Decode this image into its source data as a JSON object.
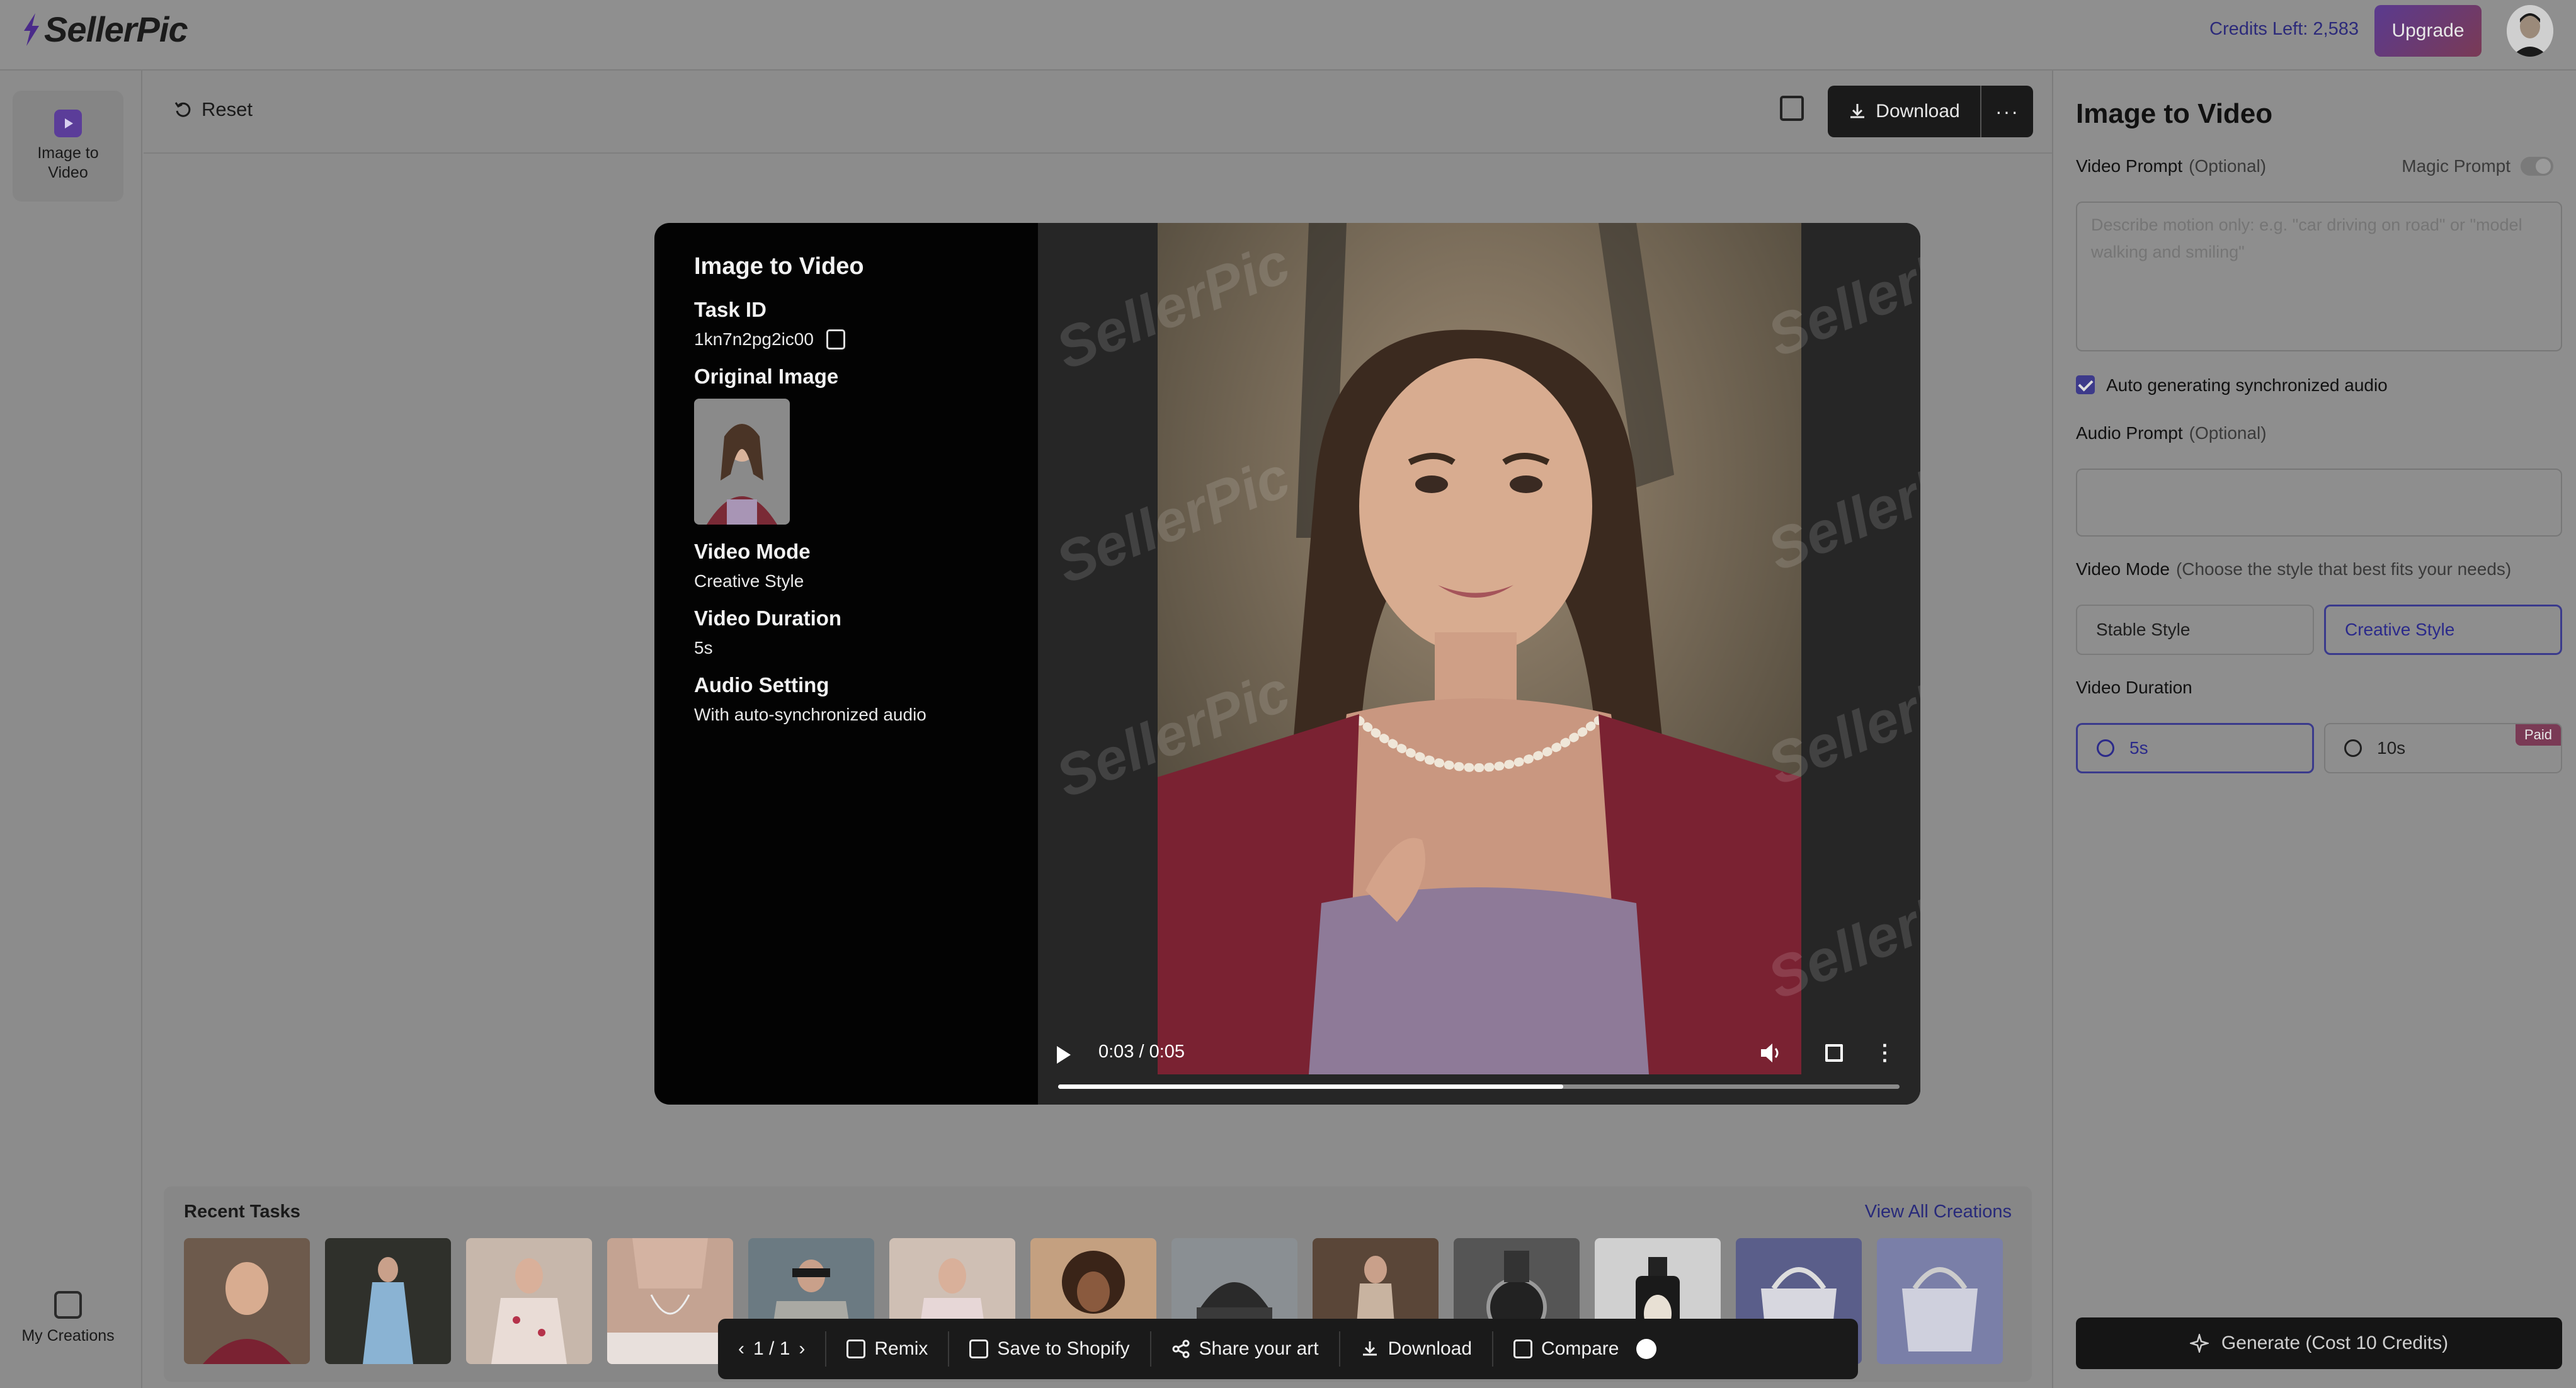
{
  "app": {
    "logo": "SellerPic",
    "credits": "Credits Left: 2,583",
    "upgrade_label": "Upgrade"
  },
  "sidebar": {
    "items": [
      {
        "label": "Image to Video",
        "icon": "video-icon"
      }
    ],
    "bottom_label": "My Creations"
  },
  "toolbar": {
    "reset_label": "Reset",
    "download_label": "Download",
    "more_label": "···"
  },
  "result": {
    "title": "Image to Video",
    "task_id_label": "Task ID",
    "task_id": "1kn7n2pg2ic00",
    "original_image_label": "Original Image",
    "video_mode_label": "Video Mode",
    "video_mode": "Creative Style",
    "video_duration_label": "Video Duration",
    "video_duration": "5s",
    "audio_setting_label": "Audio Setting",
    "audio_setting": "With auto-synchronized audio",
    "watermark": "SellerPic"
  },
  "player": {
    "time": "0:03 / 0:05",
    "progress": 0.6
  },
  "recent": {
    "title": "Recent Tasks",
    "view_all": "View All Creations",
    "count": 13
  },
  "bottom_bar": {
    "pager": "1 / 1",
    "remix": "Remix",
    "save_shopify": "Save to Shopify",
    "share": "Share your art",
    "download": "Download",
    "compare": "Compare"
  },
  "panel": {
    "title": "Image to Video",
    "video_prompt_label": "Video Prompt",
    "optional": "(Optional)",
    "magic_prompt": "Magic Prompt",
    "video_prompt_placeholder": "Describe motion only: e.g. \"car driving on road\" or \"model walking and smiling\"",
    "auto_audio_label": "Auto generating synchronized audio",
    "audio_prompt_label": "Audio Prompt",
    "video_mode_label": "Video Mode",
    "video_mode_hint": "(Choose the style that best fits your needs)",
    "mode_stable": "Stable Style",
    "mode_creative": "Creative Style",
    "video_duration_label": "Video Duration",
    "dur_5": "5s",
    "dur_10": "10s",
    "paid_badge": "Paid",
    "generate_label": "Generate (Cost 10 Credits)"
  },
  "colors": {
    "accent": "#2b2a8a",
    "upgrade_gradient_start": "#5a3a8f",
    "upgrade_gradient_end": "#7a3a55",
    "overlay": "#8c8c8c"
  }
}
